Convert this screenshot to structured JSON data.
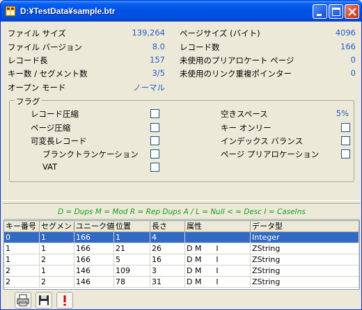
{
  "window": {
    "title": "D:¥TestData¥sample.btr"
  },
  "info_left": [
    {
      "label": "ファイル サイズ",
      "value": "139,264"
    },
    {
      "label": "ファイル バージョン",
      "value": "8.0"
    },
    {
      "label": "レコード長",
      "value": "157"
    },
    {
      "label": "キー数 / セグメント数",
      "value": "3/5"
    },
    {
      "label": "オープン モード",
      "value": "ノーマル"
    }
  ],
  "info_right": [
    {
      "label": "ページサイズ (バイト)",
      "value": "4096"
    },
    {
      "label": "レコード数",
      "value": "166"
    },
    {
      "label": "未使用のプリアロケート ページ",
      "value": "0"
    },
    {
      "label": "未使用のリンク重複ポインター",
      "value": "0"
    }
  ],
  "flags": {
    "legend": "フラグ",
    "left": [
      {
        "label": "レコード圧縮",
        "checked": false
      },
      {
        "label": "ページ圧縮",
        "checked": false
      },
      {
        "label": "可変長レコード",
        "checked": false
      },
      {
        "label": "ブランクトランケーション",
        "checked": false
      },
      {
        "label": "VAT",
        "checked": false
      }
    ],
    "right": [
      {
        "label": "空きスペース",
        "value": "5%"
      },
      {
        "label": "キー オンリー",
        "checked": false
      },
      {
        "label": "インデックス バランス",
        "checked": false
      },
      {
        "label": "ページ プリアロケーション",
        "checked": false
      }
    ]
  },
  "attr_legend": "D = Dups   M = Mod   R = Rep  Dups   A / L = Null   < = Desc   I = CaseIns",
  "table": {
    "columns": [
      "キー番号",
      "セグメント",
      "ユニーク値",
      "位置",
      "長さ",
      "属性",
      "データ型"
    ],
    "rows": [
      [
        "0",
        "1",
        "166",
        "1",
        "4",
        "",
        "Integer"
      ],
      [
        "1",
        "1",
        "166",
        "21",
        "26",
        "D M      I",
        "ZString"
      ],
      [
        "1",
        "2",
        "166",
        "5",
        "16",
        "D M      I",
        "ZString"
      ],
      [
        "2",
        "1",
        "146",
        "109",
        "3",
        "D M      I",
        "ZString"
      ],
      [
        "2",
        "2",
        "146",
        "78",
        "31",
        "D M      I",
        "ZString"
      ]
    ],
    "selected_row": 0
  },
  "toolbar": {
    "buttons": [
      "printer-icon",
      "save-icon",
      "exclamation-icon"
    ]
  },
  "colors": {
    "value": "#2a5dc9",
    "legend": "#17a017",
    "selection": "#316ac5"
  }
}
